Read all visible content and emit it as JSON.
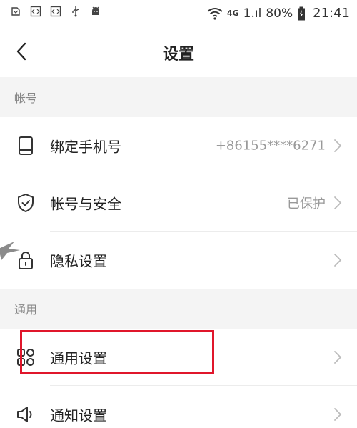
{
  "status_bar": {
    "network": "4G",
    "signal": "1.ıl",
    "battery": "80%",
    "time": "21:41"
  },
  "nav": {
    "title": "设置"
  },
  "sections": [
    {
      "header": "帐号",
      "items": [
        {
          "label": "绑定手机号",
          "value": "+86155****6271",
          "icon": "phone-icon"
        },
        {
          "label": "帐号与安全",
          "value": "已保护",
          "icon": "shield-icon"
        },
        {
          "label": "隐私设置",
          "value": "",
          "icon": "lock-icon"
        }
      ]
    },
    {
      "header": "通用",
      "items": [
        {
          "label": "通用设置",
          "value": "",
          "icon": "grid-icon"
        },
        {
          "label": "通知设置",
          "value": "",
          "icon": "speaker-icon"
        }
      ]
    }
  ],
  "colors": {
    "highlight": "#e0162b",
    "section_bg": "#f4f4f4",
    "text_primary": "#222222",
    "text_secondary": "#999999"
  }
}
